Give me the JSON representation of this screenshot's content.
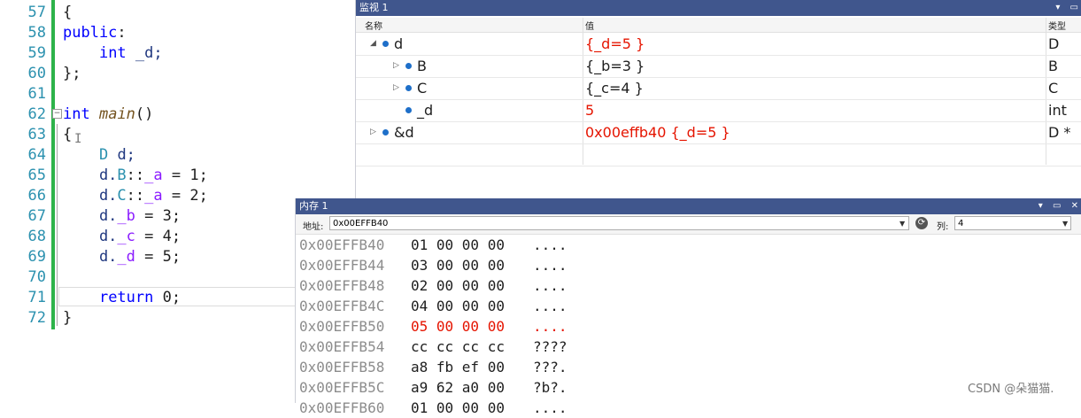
{
  "editor": {
    "lines": [
      {
        "no": "57",
        "parts": [
          {
            "t": "{",
            "c": "txt"
          }
        ]
      },
      {
        "no": "58",
        "parts": [
          {
            "t": "public",
            "c": "kw"
          },
          {
            "t": ":",
            "c": "txt"
          }
        ]
      },
      {
        "no": "59",
        "parts": [
          {
            "t": "    ",
            "c": "txt"
          },
          {
            "t": "int",
            "c": "kw"
          },
          {
            "t": " _d;",
            "c": "var"
          }
        ]
      },
      {
        "no": "60",
        "parts": [
          {
            "t": "};",
            "c": "txt"
          }
        ]
      },
      {
        "no": "61",
        "parts": []
      },
      {
        "no": "62",
        "parts": [
          {
            "t": "int",
            "c": "kw"
          },
          {
            "t": " ",
            "c": "txt"
          },
          {
            "t": "main",
            "c": "fn"
          },
          {
            "t": "()",
            "c": "txt"
          }
        ]
      },
      {
        "no": "63",
        "parts": [
          {
            "t": "{",
            "c": "txt"
          }
        ]
      },
      {
        "no": "64",
        "parts": [
          {
            "t": "    ",
            "c": "txt"
          },
          {
            "t": "D",
            "c": "ty"
          },
          {
            "t": " d;",
            "c": "var"
          }
        ]
      },
      {
        "no": "65",
        "parts": [
          {
            "t": "    d.",
            "c": "var"
          },
          {
            "t": "B",
            "c": "ty"
          },
          {
            "t": "::",
            "c": "txt"
          },
          {
            "t": "_a",
            "c": "mem"
          },
          {
            "t": " = ",
            "c": "txt"
          },
          {
            "t": "1",
            "c": "txt"
          },
          {
            "t": ";",
            "c": "txt"
          }
        ]
      },
      {
        "no": "66",
        "parts": [
          {
            "t": "    d.",
            "c": "var"
          },
          {
            "t": "C",
            "c": "ty"
          },
          {
            "t": "::",
            "c": "txt"
          },
          {
            "t": "_a",
            "c": "mem"
          },
          {
            "t": " = ",
            "c": "txt"
          },
          {
            "t": "2",
            "c": "txt"
          },
          {
            "t": ";",
            "c": "txt"
          }
        ]
      },
      {
        "no": "67",
        "parts": [
          {
            "t": "    d.",
            "c": "var"
          },
          {
            "t": "_b",
            "c": "mem"
          },
          {
            "t": " = ",
            "c": "txt"
          },
          {
            "t": "3",
            "c": "txt"
          },
          {
            "t": ";",
            "c": "txt"
          }
        ]
      },
      {
        "no": "68",
        "parts": [
          {
            "t": "    d.",
            "c": "var"
          },
          {
            "t": "_c",
            "c": "mem"
          },
          {
            "t": " = ",
            "c": "txt"
          },
          {
            "t": "4",
            "c": "txt"
          },
          {
            "t": ";",
            "c": "txt"
          }
        ]
      },
      {
        "no": "69",
        "parts": [
          {
            "t": "    d.",
            "c": "var"
          },
          {
            "t": "_d",
            "c": "mem"
          },
          {
            "t": " = ",
            "c": "txt"
          },
          {
            "t": "5",
            "c": "txt"
          },
          {
            "t": ";",
            "c": "txt"
          }
        ]
      },
      {
        "no": "70",
        "parts": []
      },
      {
        "no": "71",
        "parts": [
          {
            "t": "    ",
            "c": "txt"
          },
          {
            "t": "return",
            "c": "kw"
          },
          {
            "t": " 0;",
            "c": "txt"
          }
        ]
      },
      {
        "no": "72",
        "parts": [
          {
            "t": "}",
            "c": "txt"
          }
        ]
      }
    ],
    "cursor_glyph": "I"
  },
  "watch": {
    "title": "监视 1",
    "col_name": "名称",
    "col_value": "值",
    "col_type": "类型",
    "rows": [
      {
        "name": "d",
        "value": "{_d=5 }",
        "type": "D",
        "value_red": true,
        "expand": "◢"
      },
      {
        "name": "B",
        "value": "{_b=3 }",
        "type": "B",
        "value_red": false,
        "expand": "▷"
      },
      {
        "name": "C",
        "value": "{_c=4 }",
        "type": "C",
        "value_red": false,
        "expand": "▷"
      },
      {
        "name": "_d",
        "value": "5",
        "type": "int",
        "value_red": true,
        "expand": ""
      },
      {
        "name": "&d",
        "value": "0x00effb40 {_d=5 }",
        "type": "D *",
        "value_red": true,
        "expand": "▷"
      }
    ]
  },
  "memory": {
    "title": "内存 1",
    "address_label": "地址:",
    "address_value": "0x00EFFB40",
    "columns_label": "列:",
    "columns_value": "4",
    "rows": [
      {
        "addr": "0x00EFFB40",
        "bytes": "01 00 00 00",
        "ascii": "....",
        "changed": false
      },
      {
        "addr": "0x00EFFB44",
        "bytes": "03 00 00 00",
        "ascii": "....",
        "changed": false
      },
      {
        "addr": "0x00EFFB48",
        "bytes": "02 00 00 00",
        "ascii": "....",
        "changed": false
      },
      {
        "addr": "0x00EFFB4C",
        "bytes": "04 00 00 00",
        "ascii": "....",
        "changed": false
      },
      {
        "addr": "0x00EFFB50",
        "bytes": "05 00 00 00",
        "ascii": "....",
        "changed": true
      },
      {
        "addr": "0x00EFFB54",
        "bytes": "cc cc cc cc",
        "ascii": "????",
        "changed": false
      },
      {
        "addr": "0x00EFFB58",
        "bytes": "a8 fb ef 00",
        "ascii": "???.",
        "changed": false
      },
      {
        "addr": "0x00EFFB5C",
        "bytes": "a9 62 a0 00",
        "ascii": "?b?.",
        "changed": false
      },
      {
        "addr": "0x00EFFB60",
        "bytes": "01 00 00 00",
        "ascii": "....",
        "changed": false
      }
    ]
  },
  "watermark": "CSDN @朵猫猫.",
  "colors": {
    "highlight_red": "#e51400",
    "title_bar": "#40568d",
    "change_bar": "#2db34a",
    "line_numbers": "#2b91af"
  }
}
